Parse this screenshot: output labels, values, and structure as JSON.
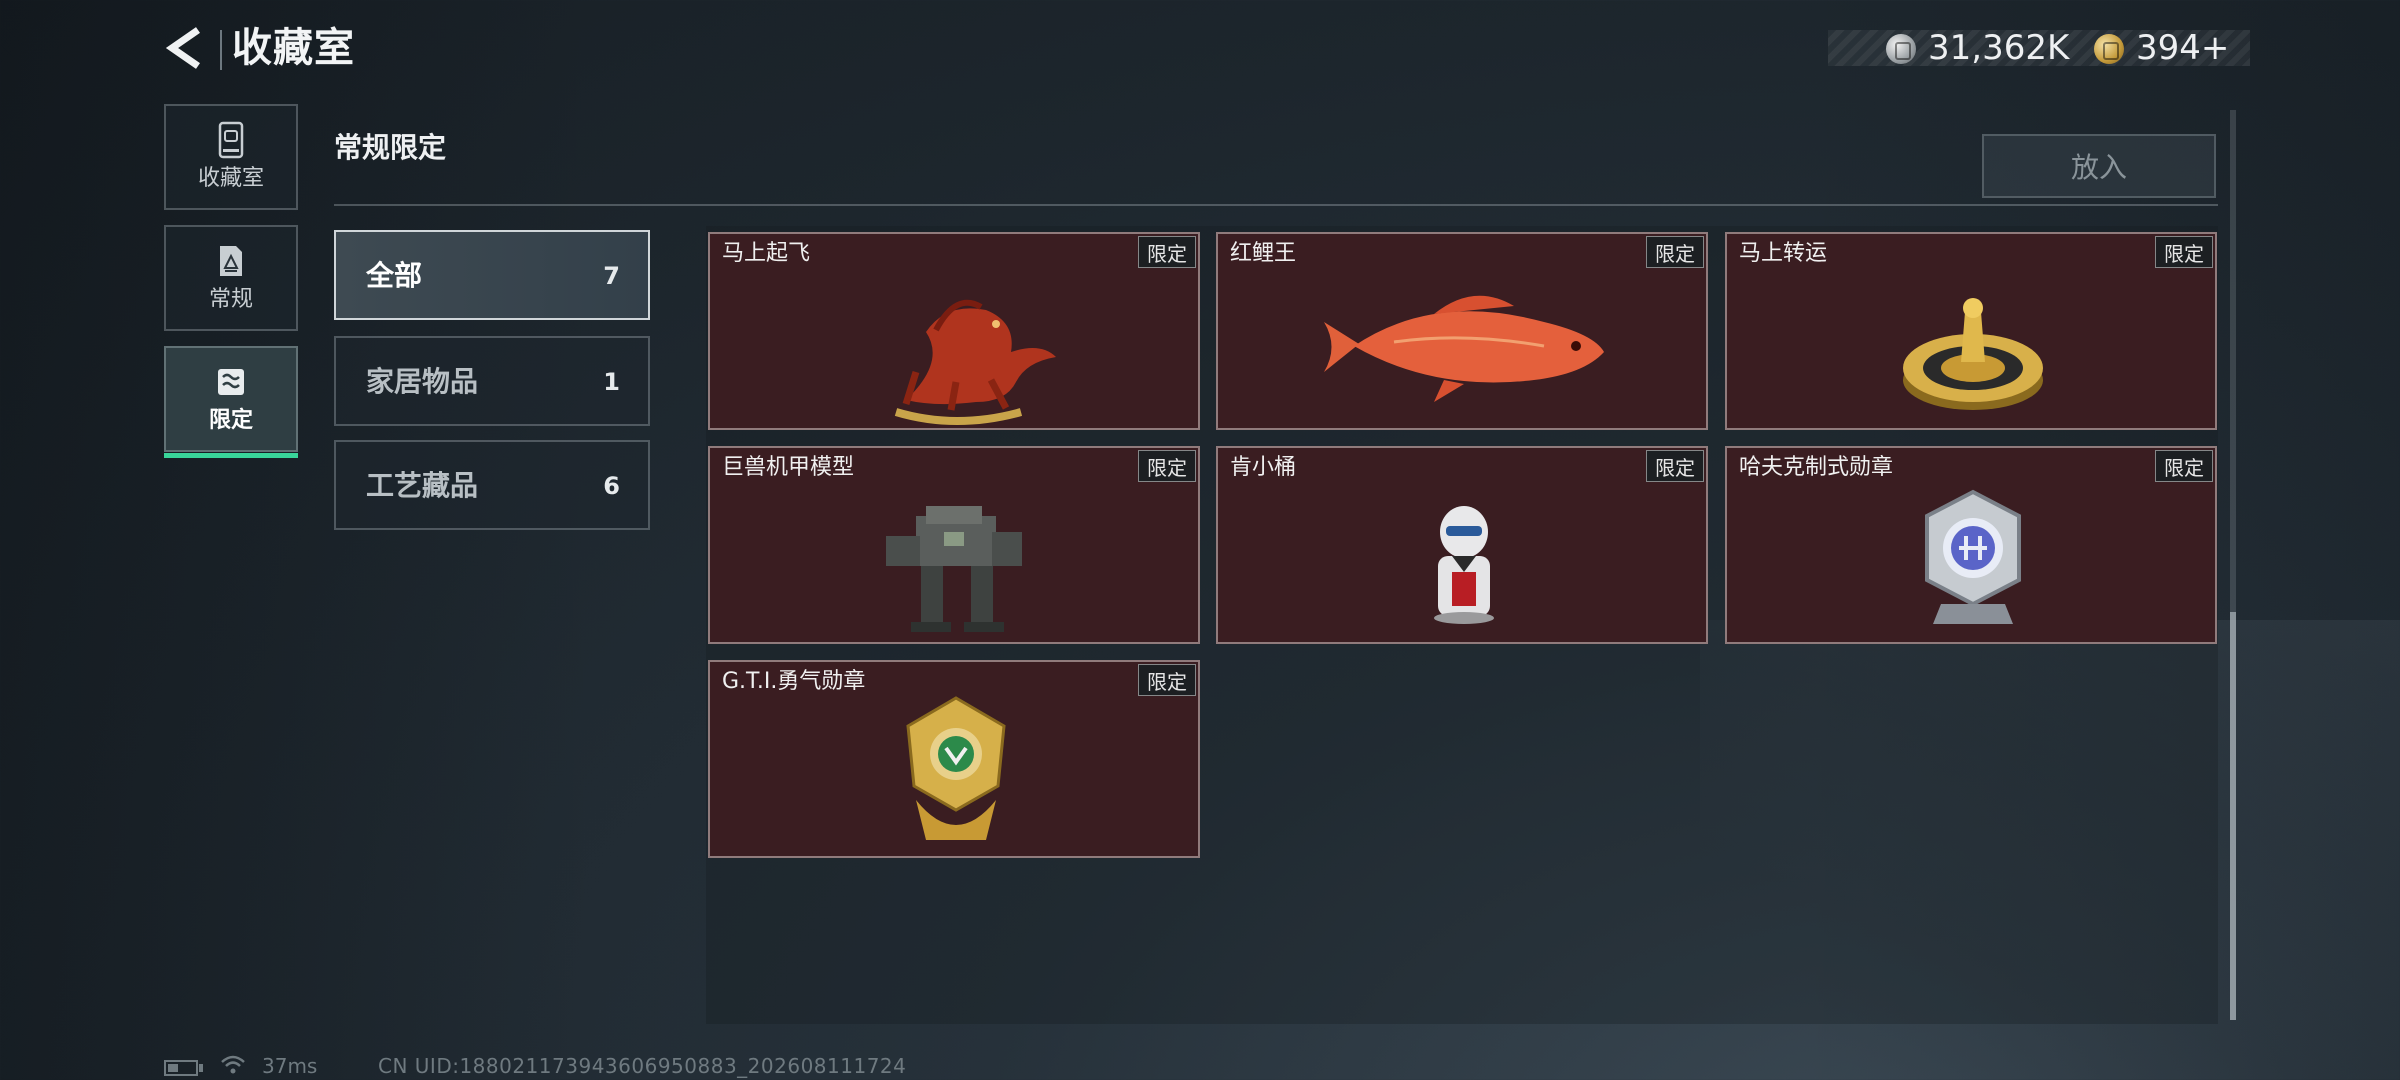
{
  "header": {
    "title": "收藏室",
    "currency": [
      {
        "icon": "silver-coin-icon",
        "value": "31,362K"
      },
      {
        "icon": "gold-coin-icon",
        "value": "394+"
      }
    ]
  },
  "sidebar": {
    "items": [
      {
        "label": "收藏室",
        "icon": "display-case-icon",
        "selected": false
      },
      {
        "label": "常规",
        "icon": "standard-item-icon",
        "selected": false
      },
      {
        "label": "限定",
        "icon": "limited-item-icon",
        "selected": true
      }
    ]
  },
  "section": {
    "title": "常规限定",
    "put_button": "放入"
  },
  "categories": [
    {
      "label": "全部",
      "count": "7",
      "selected": true
    },
    {
      "label": "家居物品",
      "count": "1",
      "selected": false
    },
    {
      "label": "工艺藏品",
      "count": "6",
      "selected": false
    }
  ],
  "items": [
    {
      "name": "马上起飞",
      "badge": "限定",
      "art": "rocking-horse-icon"
    },
    {
      "name": "红鲤王",
      "badge": "限定",
      "art": "red-carp-icon"
    },
    {
      "name": "马上转运",
      "badge": "限定",
      "art": "gold-seal-icon"
    },
    {
      "name": "巨兽机甲模型",
      "badge": "限定",
      "art": "mech-model-icon"
    },
    {
      "name": "肯小桶",
      "badge": "限定",
      "art": "chef-figurine-icon"
    },
    {
      "name": "哈夫克制式勋章",
      "badge": "限定",
      "art": "silver-medal-icon"
    },
    {
      "name": "G.T.I.勇气勋章",
      "badge": "限定",
      "art": "gold-medal-icon"
    }
  ],
  "footer": {
    "ping": "37ms",
    "uid": "CN UID:18802117394360695088​3_202608111724"
  },
  "colors": {
    "accent_green": "#39d59a",
    "card_bg": "#3a1d21"
  }
}
